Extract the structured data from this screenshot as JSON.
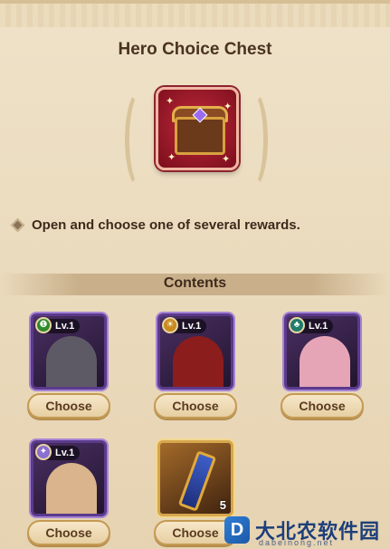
{
  "dialog": {
    "title": "Hero Choice Chest",
    "description": "Open and choose one of several rewards.",
    "contents_label": "Contents"
  },
  "colors": {
    "chest_tile": "#c02a3a",
    "epic_frame": "#5b3a8c",
    "gold_frame": "#d7a64d",
    "button_text": "#5a3b20"
  },
  "rewards": [
    {
      "level": "Lv.1",
      "faction_icon": "nature-faction-icon",
      "button": "Choose",
      "portrait_color": "#5d5a66"
    },
    {
      "level": "Lv.1",
      "faction_icon": "sun-faction-icon",
      "button": "Choose",
      "portrait_color": "#8b1d1d"
    },
    {
      "level": "Lv.1",
      "faction_icon": "forest-faction-icon",
      "button": "Choose",
      "portrait_color": "#e6a5b7"
    },
    {
      "level": "Lv.1",
      "faction_icon": "star-faction-icon",
      "button": "Choose",
      "portrait_color": "#d9b48c"
    },
    {
      "item": "gear-item-icon",
      "quantity": "5",
      "button": "Choose"
    }
  ],
  "watermark": {
    "logo_letter": "D",
    "text": "大北农软件园",
    "subtext": "dabeinong.net"
  }
}
